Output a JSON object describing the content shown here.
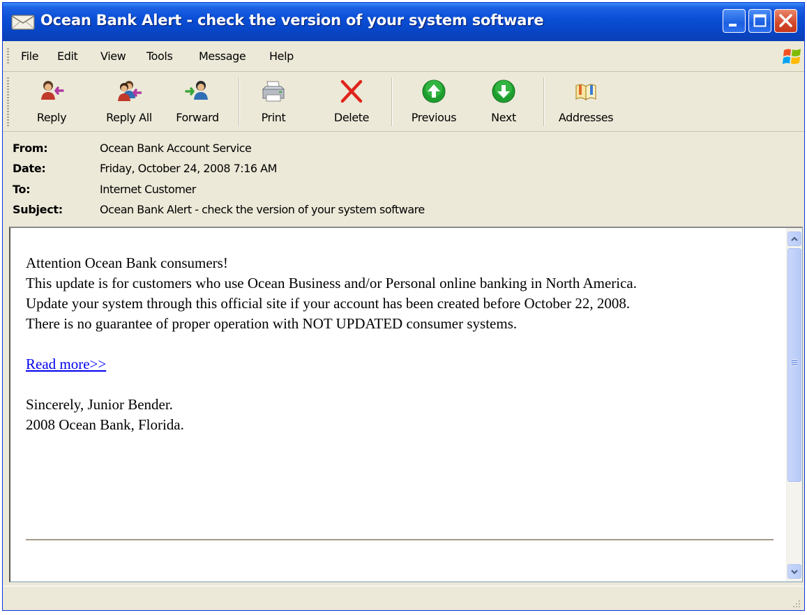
{
  "window": {
    "title": "Ocean Bank Alert - check the version of your system software"
  },
  "menu": [
    "File",
    "Edit",
    "View",
    "Tools",
    "Message",
    "Help"
  ],
  "toolbar": [
    {
      "label": "Reply",
      "icon": "reply-icon"
    },
    {
      "label": "Reply All",
      "icon": "reply-all-icon"
    },
    {
      "label": "Forward",
      "icon": "forward-icon"
    },
    {
      "label": "Print",
      "icon": "printer-icon"
    },
    {
      "label": "Delete",
      "icon": "delete-x-icon"
    },
    {
      "label": "Previous",
      "icon": "arrow-up-icon"
    },
    {
      "label": "Next",
      "icon": "arrow-down-icon"
    },
    {
      "label": "Addresses",
      "icon": "address-book-icon"
    }
  ],
  "headers": {
    "from_label": "From:",
    "from": "Ocean Bank Account Service",
    "date_label": "Date:",
    "date": "Friday, October 24, 2008 7:16 AM",
    "to_label": "To:",
    "to": "Internet Customer",
    "subject_label": "Subject:",
    "subject": "Ocean Bank Alert - check the version of your system software"
  },
  "message": {
    "line1": "Attention Ocean Bank consumers!",
    "line2": "This update is for customers who use Ocean Business and/or Personal online banking in North America.",
    "line3": "Update your system through this official site if your account has been created before October 22, 2008.",
    "line4": "There is no guarantee of proper operation with NOT UPDATED consumer systems.",
    "link": "Read more>>",
    "sign1": "Sincerely, Junior Bender.",
    "sign2": "2008 Ocean Bank, Florida."
  },
  "colors": {
    "titlebar": "#0a4fd6",
    "chrome": "#ece9d8",
    "link": "#0000ee",
    "close": "#d2472a"
  }
}
